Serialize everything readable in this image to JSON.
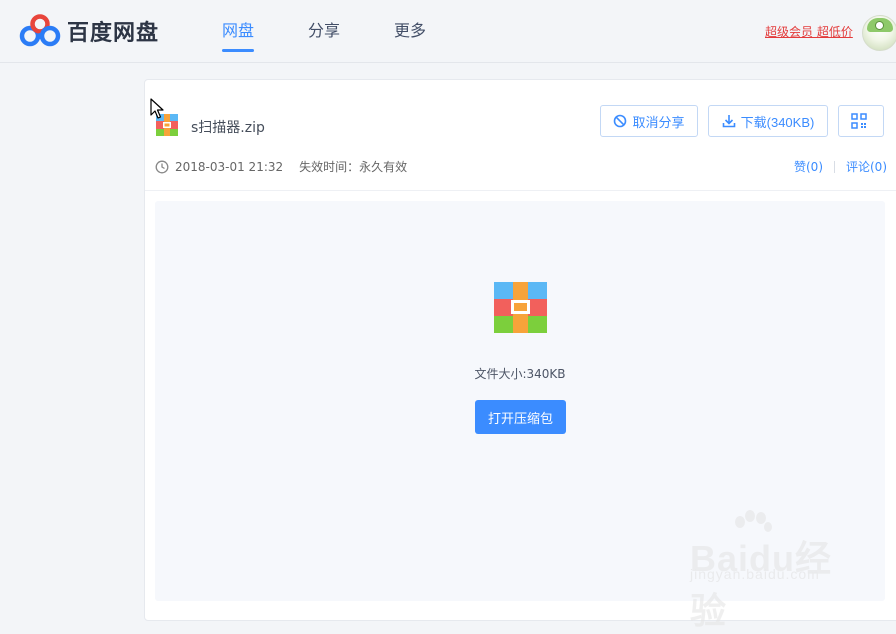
{
  "header": {
    "brand": "百度网盘",
    "nav": [
      {
        "label": "网盘",
        "active": true
      },
      {
        "label": "分享",
        "active": false
      },
      {
        "label": "更多",
        "active": false
      }
    ],
    "promo": "超级会员 超低价"
  },
  "file": {
    "name": "s扫描器.zip",
    "cancel_share_label": "取消分享",
    "download_label": "下载(340KB)",
    "qr_icon": "qrcode-icon",
    "date": "2018-03-01 21:32",
    "expiry": "失效时间：永久有效",
    "likes": "赞(0)",
    "comments": "评论(0)"
  },
  "preview": {
    "size_text": "文件大小:340KB",
    "open_label": "打开压缩包"
  },
  "watermark": {
    "line1": "Baidu经验",
    "line2": "jingyan.baidu.com"
  },
  "colors": {
    "accent": "#3b8cff",
    "promo": "#e33b3b"
  }
}
